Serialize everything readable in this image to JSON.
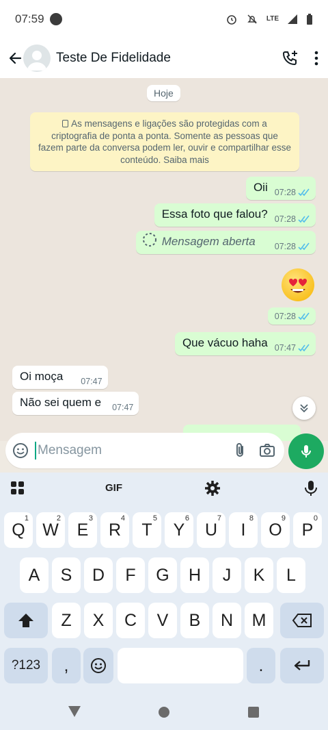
{
  "status_bar": {
    "time": "07:59",
    "network": "LTE"
  },
  "header": {
    "title": "Teste De Fidelidade"
  },
  "chat": {
    "date_chip": "Hoje",
    "encryption_note": "As mensagens e ligações são protegidas com a criptografia de ponta a ponta. Somente as pessoas que fazem parte da conversa podem ler, ouvir e compartilhar esse conteúdo. Saiba mais",
    "messages": [
      {
        "text": "Oii",
        "time": "07:28"
      },
      {
        "text": "Essa foto que falou?",
        "time": "07:28"
      },
      {
        "text": "Mensagem aberta",
        "time": "07:28"
      },
      {
        "emoji": "heart-eyes-emoji",
        "time": "07:28"
      },
      {
        "text": "Que vácuo haha",
        "time": "07:47"
      },
      {
        "text": "Oi moça",
        "time": "07:47"
      },
      {
        "text": "Não sei quem e",
        "time": "07:47"
      }
    ]
  },
  "composer": {
    "placeholder": "Mensagem"
  },
  "keyboard": {
    "toolbar": {
      "gif_label": "GIF"
    },
    "row1": [
      {
        "key": "Q",
        "hint": "1"
      },
      {
        "key": "W",
        "hint": "2"
      },
      {
        "key": "E",
        "hint": "3"
      },
      {
        "key": "R",
        "hint": "4"
      },
      {
        "key": "T",
        "hint": "5"
      },
      {
        "key": "Y",
        "hint": "6"
      },
      {
        "key": "U",
        "hint": "7"
      },
      {
        "key": "I",
        "hint": "8"
      },
      {
        "key": "O",
        "hint": "9"
      },
      {
        "key": "P",
        "hint": "0"
      }
    ],
    "row2": [
      "A",
      "S",
      "D",
      "F",
      "G",
      "H",
      "J",
      "K",
      "L"
    ],
    "row3": [
      "Z",
      "X",
      "C",
      "V",
      "B",
      "N",
      "M"
    ],
    "symbols_label": "?123",
    "comma_label": ",",
    "period_label": "."
  },
  "colors": {
    "accent": "#1daa61",
    "outgoing_bubble": "#d9fdd3",
    "incoming_bubble": "#ffffff",
    "read_ticks": "#53bdeb"
  },
  "icons": [
    "back-icon",
    "add-call-icon",
    "more-vert-icon",
    "lock-icon",
    "loading-icon",
    "double-check-icon",
    "chevron-double-down-icon",
    "sticker-icon",
    "attach-icon",
    "camera-icon",
    "mic-icon",
    "apps-grid-icon",
    "gear-icon",
    "shift-icon",
    "backspace-icon",
    "emoji-icon",
    "enter-icon",
    "nav-back-icon",
    "nav-home-icon",
    "nav-recents-icon"
  ]
}
